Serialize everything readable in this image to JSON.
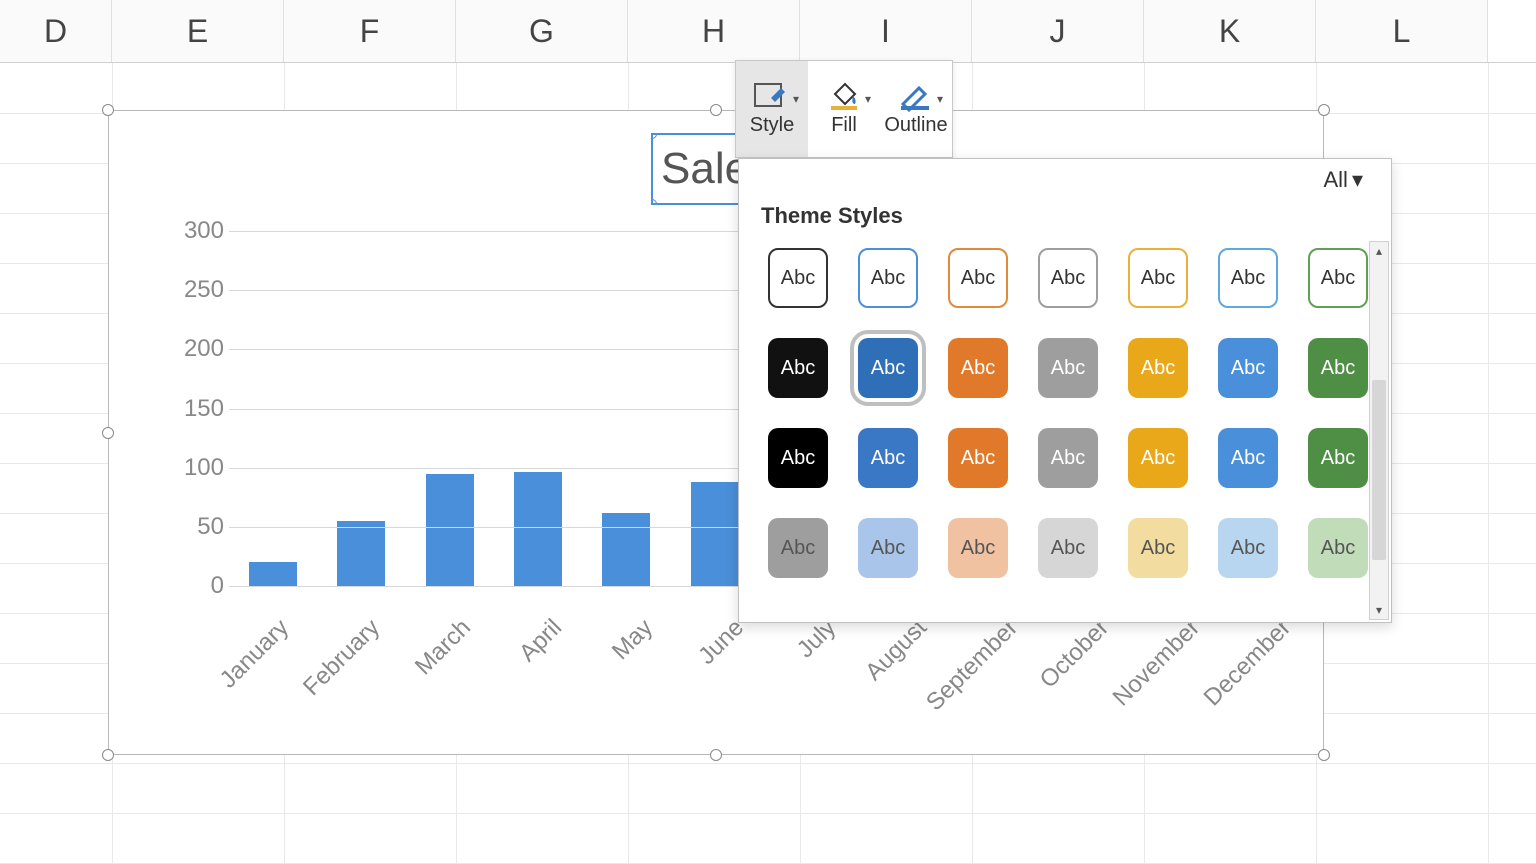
{
  "columns": [
    "D",
    "E",
    "F",
    "G",
    "H",
    "I",
    "J",
    "K",
    "L"
  ],
  "chart_title_visible": "Sale",
  "toolbar": {
    "style": "Style",
    "fill": "Fill",
    "outline": "Outline"
  },
  "gallery": {
    "filter_label": "All",
    "section_label": "Theme Styles",
    "swatch_text": "Abc",
    "rows": [
      {
        "type": "outline",
        "colors": [
          "#333333",
          "#4a8fd9",
          "#e08a3a",
          "#9e9e9e",
          "#e8b23a",
          "#5ea8e0",
          "#5fa055"
        ]
      },
      {
        "type": "solid",
        "colors": [
          "#111111",
          "#2f6fb8",
          "#e07a2a",
          "#9e9e9e",
          "#e8a81a",
          "#4a8fd9",
          "#4f8f45"
        ],
        "hover_index": 1
      },
      {
        "type": "solid",
        "colors": [
          "#000000",
          "#3a77c4",
          "#e07a2a",
          "#9e9e9e",
          "#e8a81a",
          "#4a8fd9",
          "#4f8f45"
        ]
      },
      {
        "type": "light",
        "colors": [
          "#9e9e9e",
          "#a9c5ea",
          "#f0c2a2",
          "#d6d6d6",
          "#f2dca0",
          "#b8d6f0",
          "#c0dcb8"
        ]
      }
    ]
  },
  "chart_data": {
    "type": "bar",
    "title": "Sales",
    "categories": [
      "January",
      "February",
      "March",
      "April",
      "May",
      "June",
      "July",
      "August",
      "September",
      "October",
      "November",
      "December"
    ],
    "values": [
      20,
      55,
      95,
      96,
      62,
      88,
      null,
      null,
      null,
      null,
      null,
      null
    ],
    "ylabel": "",
    "xlabel": "",
    "ylim": [
      0,
      300
    ],
    "yticks": [
      0,
      50,
      100,
      150,
      200,
      250,
      300
    ]
  }
}
